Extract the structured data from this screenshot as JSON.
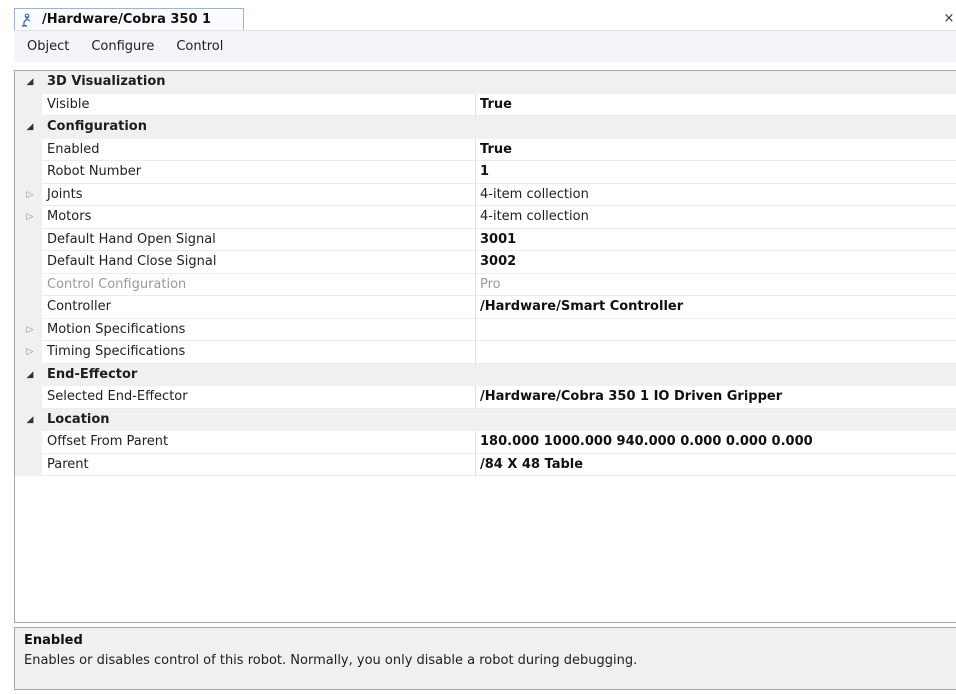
{
  "tab": {
    "title": "/Hardware/Cobra 350 1",
    "icon": "robot-arm-icon",
    "close_label": "×"
  },
  "menu": [
    "Object",
    "Configure",
    "Control"
  ],
  "grid": {
    "rows": [
      {
        "kind": "category",
        "label": "3D Visualization",
        "glyph": "◢"
      },
      {
        "kind": "property",
        "name": "Visible",
        "value": "True",
        "bold": true
      },
      {
        "kind": "category",
        "label": "Configuration",
        "glyph": "◢"
      },
      {
        "kind": "property",
        "name": "Enabled",
        "value": "True",
        "bold": true
      },
      {
        "kind": "property",
        "name": "Robot Number",
        "value": "1",
        "bold": true
      },
      {
        "kind": "property",
        "name": "Joints",
        "value": "4-item collection",
        "bold": false,
        "expandable": true,
        "glyph": "▷"
      },
      {
        "kind": "property",
        "name": "Motors",
        "value": "4-item collection",
        "bold": false,
        "expandable": true,
        "glyph": "▷"
      },
      {
        "kind": "property",
        "name": "Default Hand Open Signal",
        "value": "3001",
        "bold": true
      },
      {
        "kind": "property",
        "name": "Default Hand Close Signal",
        "value": "3002",
        "bold": true
      },
      {
        "kind": "property",
        "name": "Control Configuration",
        "value": "Pro",
        "bold": false,
        "disabled": true
      },
      {
        "kind": "property",
        "name": "Controller",
        "value": "/Hardware/Smart Controller",
        "bold": true
      },
      {
        "kind": "property",
        "name": "Motion Specifications",
        "value": "",
        "bold": false,
        "expandable": true,
        "glyph": "▷"
      },
      {
        "kind": "property",
        "name": "Timing Specifications",
        "value": "",
        "bold": false,
        "expandable": true,
        "glyph": "▷"
      },
      {
        "kind": "category",
        "label": "End-Effector",
        "glyph": "◢"
      },
      {
        "kind": "property",
        "name": "Selected End-Effector",
        "value": "/Hardware/Cobra 350 1 IO Driven Gripper",
        "bold": true
      },
      {
        "kind": "category",
        "label": "Location",
        "glyph": "◢"
      },
      {
        "kind": "property",
        "name": "Offset From Parent",
        "value": "180.000 1000.000 940.000 0.000 0.000 0.000",
        "bold": true
      },
      {
        "kind": "property",
        "name": "Parent",
        "value": "/84 X 48 Table",
        "bold": true
      }
    ]
  },
  "help": {
    "title": "Enabled",
    "text": "Enables or disables control of this robot. Normally, you only disable a robot during debugging."
  }
}
